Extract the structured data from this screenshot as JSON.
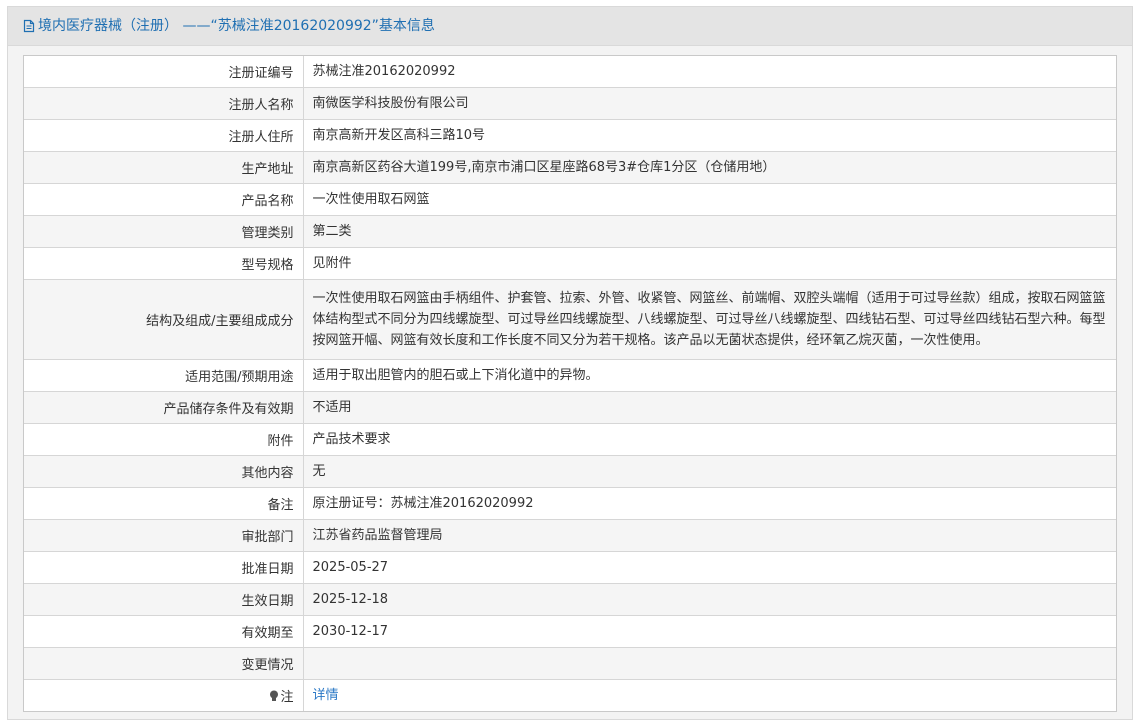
{
  "header": {
    "title": "境内医疗器械（注册） ——“苏械注准20162020992”基本信息"
  },
  "fields": [
    {
      "label": "注册证编号",
      "value": "苏械注准20162020992"
    },
    {
      "label": "注册人名称",
      "value": "南微医学科技股份有限公司"
    },
    {
      "label": "注册人住所",
      "value": "南京高新开发区高科三路10号"
    },
    {
      "label": "生产地址",
      "value": "南京高新区药谷大道199号,南京市浦口区星座路68号3#仓库1分区（仓储用地）"
    },
    {
      "label": "产品名称",
      "value": "一次性使用取石网篮"
    },
    {
      "label": "管理类别",
      "value": "第二类"
    },
    {
      "label": "型号规格",
      "value": "见附件"
    },
    {
      "label": "结构及组成/主要组成成分",
      "value": "一次性使用取石网篮由手柄组件、护套管、拉索、外管、收紧管、网篮丝、前端帽、双腔头端帽（适用于可过导丝款）组成，按取石网篮篮体结构型式不同分为四线螺旋型、可过导丝四线螺旋型、八线螺旋型、可过导丝八线螺旋型、四线钻石型、可过导丝四线钻石型六种。每型按网篮开幅、网篮有效长度和工作长度不同又分为若干规格。该产品以无菌状态提供，经环氧乙烷灭菌，一次性使用。"
    },
    {
      "label": "适用范围/预期用途",
      "value": "适用于取出胆管内的胆石或上下消化道中的异物。"
    },
    {
      "label": "产品储存条件及有效期",
      "value": "不适用"
    },
    {
      "label": "附件",
      "value": "产品技术要求"
    },
    {
      "label": "其他内容",
      "value": "无"
    },
    {
      "label": "备注",
      "value": "原注册证号：苏械注准20162020992"
    },
    {
      "label": "审批部门",
      "value": "江苏省药品监督管理局"
    },
    {
      "label": "批准日期",
      "value": "2025-05-27"
    },
    {
      "label": "生效日期",
      "value": "2025-12-18"
    },
    {
      "label": "有效期至",
      "value": "2030-12-17"
    },
    {
      "label": "变更情况",
      "value": ""
    }
  ],
  "note_row": {
    "label": "注",
    "link_text": "详情"
  },
  "colors": {
    "accent": "#1f6fb2",
    "link": "#2a78c6",
    "header_bg": "#e4e4e4"
  },
  "icons": {
    "title_icon": "document-icon",
    "note_icon": "lightbulb-icon"
  }
}
